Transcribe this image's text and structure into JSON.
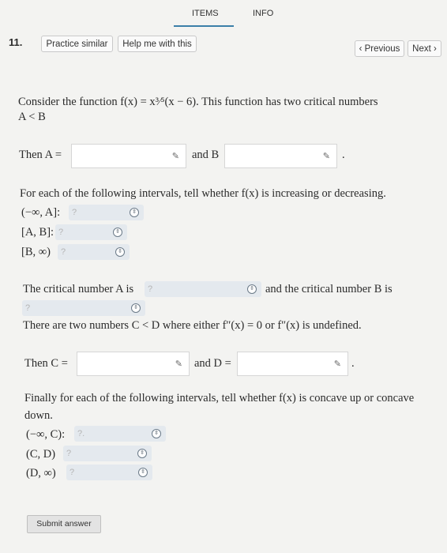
{
  "tabs": {
    "items": "ITEMS",
    "info": "INFO"
  },
  "question_number": "11.",
  "buttons": {
    "practice": "Practice similar",
    "help": "Help me with this",
    "previous": "Previous",
    "next": "Next"
  },
  "intro": {
    "line1": "Consider the function f(x) = x³⁄⁵(x − 6). This function has two critical numbers",
    "line2": "A < B"
  },
  "part_a": {
    "then_a": "Then A =",
    "and_b": "and B",
    "period": "."
  },
  "part_b": {
    "prompt": "For each of the following intervals, tell whether f(x) is increasing or decreasing.",
    "intervals": [
      "(−∞, A]:",
      "[A, B]:",
      "[B, ∞)"
    ],
    "placeholder": "?"
  },
  "part_c": {
    "text1": "The critical number A is",
    "text2": "and the critical number B is",
    "placeholder": "?"
  },
  "part_d": {
    "text": "There are two numbers C < D where either f″(x) = 0 or f″(x) is undefined.",
    "then_c": "Then C =",
    "and_d": "and D =",
    "period": "."
  },
  "part_e": {
    "line1": "Finally for each of the following intervals, tell whether f(x) is concave up or concave",
    "line2": "down.",
    "intervals": [
      "(−∞, C):",
      "(C, D)",
      "(D, ∞)"
    ],
    "placeholders": [
      "?.",
      "?",
      "?"
    ]
  },
  "submit": "Submit answer"
}
